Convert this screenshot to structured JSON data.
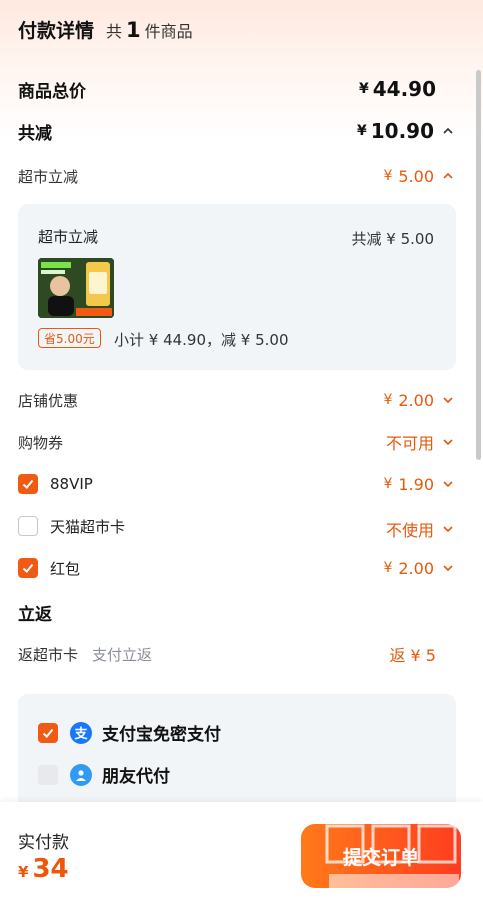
{
  "header": {
    "title": "付款详情",
    "count_prefix": "共",
    "count": "1",
    "count_suffix": "件商品"
  },
  "total": {
    "label": "商品总价",
    "currency": "¥",
    "amount": "44.90"
  },
  "reduce": {
    "label": "共减",
    "currency": "¥",
    "amount": "10.90"
  },
  "supermarket_discount": {
    "label": "超市立减",
    "currency": "¥",
    "amount": "5.00"
  },
  "discount_card": {
    "title": "超市立减",
    "total": "共减 ¥ 5.00",
    "save_tag": "省5.00元",
    "subtotal": "小计 ¥ 44.90，减 ¥ 5.00"
  },
  "store_discount": {
    "label": "店铺优惠",
    "currency": "¥",
    "amount": "2.00"
  },
  "coupon": {
    "label": "购物券",
    "value": "不可用"
  },
  "vip": {
    "label": "88VIP",
    "currency": "¥",
    "amount": "1.90",
    "checked": true
  },
  "tmall_card": {
    "label": "天猫超市卡",
    "value": "不使用",
    "checked": false
  },
  "red_packet": {
    "label": "红包",
    "currency": "¥",
    "amount": "2.00",
    "checked": true
  },
  "cashback": {
    "title": "立返",
    "label": "返超市卡",
    "sub_label": "支付立返",
    "value": "返 ¥ 5"
  },
  "payment": {
    "alipay": {
      "label": "支付宝免密支付",
      "icon": "alipay-icon",
      "checked": true
    },
    "friend": {
      "label": "朋友代付",
      "icon": "friend-pay-icon",
      "checked": false
    }
  },
  "footer": {
    "label": "实付款",
    "currency": "¥",
    "amount": "34",
    "submit": "提交订单"
  },
  "colors": {
    "accent": "#f05a12",
    "orange_text": "#e8590c",
    "card_bg": "#f2f5f8"
  }
}
